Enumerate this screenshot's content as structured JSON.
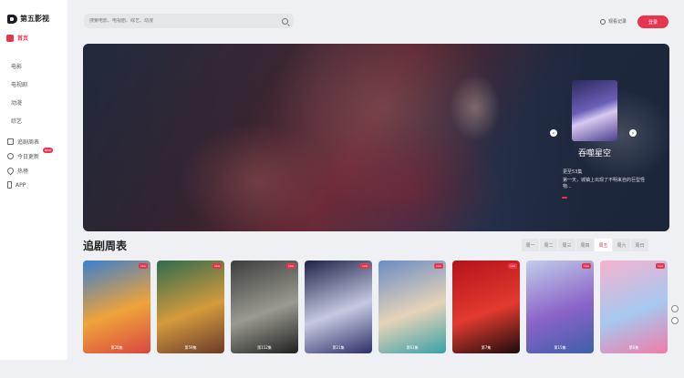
{
  "brand": {
    "name": "第五影视"
  },
  "sidebar": {
    "home_label": "首页",
    "items": [
      "电影",
      "电视剧",
      "动漫",
      "综艺"
    ],
    "extras": [
      {
        "label": "追剧周表",
        "icon": "calendar-icon"
      },
      {
        "label": "今日更新",
        "icon": "clock-icon",
        "badge": "NEW"
      },
      {
        "label": "热榜",
        "icon": "fire-icon"
      },
      {
        "label": "APP",
        "icon": "phone-icon"
      }
    ]
  },
  "search": {
    "placeholder": "搜索电影、电视剧、综艺、动漫"
  },
  "header": {
    "history_label": "观看记录",
    "login_label": "登录"
  },
  "banner": {
    "featured_title": "吞噬星空",
    "featured_sub": "更至53集",
    "featured_desc": "第一天，城镇上出现了不明来自的巨型怪物...",
    "prev_icon": "chevron-left-icon",
    "next_icon": "chevron-right-icon"
  },
  "schedule": {
    "title": "追剧周表",
    "days": [
      "周一",
      "周二",
      "周三",
      "周四",
      "周五",
      "周六",
      "周日"
    ],
    "active_day": "周五"
  },
  "posters": [
    {
      "episode": "第20集",
      "tag": "new",
      "colors": [
        "#3a7fd0",
        "#f0a33a",
        "#d9463f"
      ]
    },
    {
      "episode": "第59集",
      "tag": "new",
      "colors": [
        "#2f6b4f",
        "#d49b3c",
        "#6a3a2a"
      ]
    },
    {
      "episode": "第112集",
      "tag": "new",
      "colors": [
        "#3d3d3d",
        "#9a9a90",
        "#1f1f1f"
      ]
    },
    {
      "episode": "第21集",
      "tag": "new",
      "colors": [
        "#1d2348",
        "#c7c9e2",
        "#2b2f66"
      ]
    },
    {
      "episode": "第61集",
      "tag": "new",
      "colors": [
        "#6a8cc4",
        "#e6d3b8",
        "#38a0a8"
      ]
    },
    {
      "episode": "第7集",
      "tag": "new",
      "colors": [
        "#b5121c",
        "#e23a2f",
        "#1a0c0d"
      ]
    },
    {
      "episode": "第15集",
      "tag": "new",
      "colors": [
        "#c1cdea",
        "#8b63c9",
        "#3d5fa8"
      ]
    },
    {
      "episode": "第6集",
      "tag": "new",
      "colors": [
        "#f5b3cf",
        "#a6c8f0",
        "#f07ca8"
      ]
    }
  ]
}
